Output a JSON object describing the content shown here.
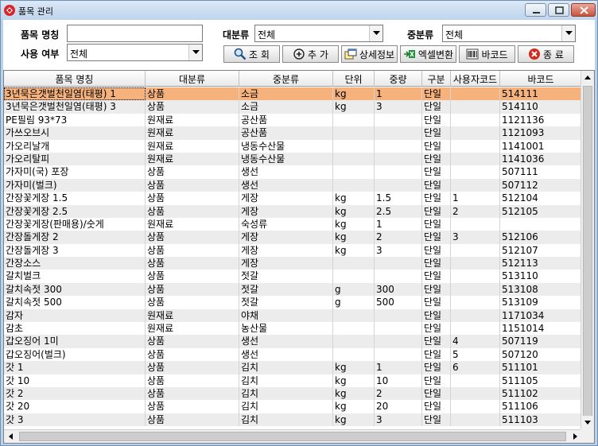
{
  "window": {
    "title": "품목 관리"
  },
  "filters": {
    "item_name_label": "품목 명칭",
    "item_name_value": "",
    "usage_label": "사용 여부",
    "usage_value": "전체",
    "major_label": "대분류",
    "major_value": "전체",
    "minor_label": "중분류",
    "minor_value": "전체"
  },
  "toolbar": {
    "search_label": "조 회",
    "add_label": "추 가",
    "detail_label": "상세정보",
    "excel_label": "엑셀변환",
    "barcode_label": "바코드",
    "close_label": "종 료"
  },
  "grid": {
    "columns": [
      "품목 명칭",
      "대분류",
      "중분류",
      "단위",
      "중량",
      "구분",
      "사용자코드",
      "바코드"
    ],
    "rows": [
      [
        "3년묵은갯벌천일염(태평) 1",
        "상품",
        "소금",
        "kg",
        "1",
        "단일",
        "",
        "514111"
      ],
      [
        "3년묵은갯벌천일염(태평) 3",
        "상품",
        "소금",
        "kg",
        "3",
        "단일",
        "",
        "514110"
      ],
      [
        "PE필림 93*73",
        "원재료",
        "공산품",
        "",
        "",
        "단일",
        "",
        "1121136"
      ],
      [
        "가쓰오브시",
        "원재료",
        "공산품",
        "",
        "",
        "단일",
        "",
        "1121093"
      ],
      [
        "가오리날개",
        "원재료",
        "냉동수산물",
        "",
        "",
        "단일",
        "",
        "1141001"
      ],
      [
        "가오리탈피",
        "원재료",
        "냉동수산물",
        "",
        "",
        "단일",
        "",
        "1141036"
      ],
      [
        "가자미(국) 포장",
        "상품",
        "생선",
        "",
        "",
        "단일",
        "",
        "507111"
      ],
      [
        "가자미(벌크)",
        "상품",
        "생선",
        "",
        "",
        "단일",
        "",
        "507112"
      ],
      [
        "간장꽃게장 1.5",
        "상품",
        "게장",
        "kg",
        "1.5",
        "단일",
        "1",
        "512104"
      ],
      [
        "간장꽃게장 2.5",
        "상품",
        "게장",
        "kg",
        "2.5",
        "단일",
        "2",
        "512105"
      ],
      [
        "간장꽃게장(판매용)/숫게",
        "원재료",
        "숙성류",
        "kg",
        "1",
        "단일",
        "",
        ""
      ],
      [
        "간장돌게장 2",
        "상품",
        "게장",
        "kg",
        "2",
        "단일",
        "3",
        "512106"
      ],
      [
        "간장돌게장 3",
        "상품",
        "게장",
        "kg",
        "3",
        "단일",
        "",
        "512107"
      ],
      [
        "간장소스",
        "상품",
        "게장",
        "",
        "",
        "단일",
        "",
        "512113"
      ],
      [
        "갈치벌크",
        "상품",
        "젓갈",
        "",
        "",
        "단일",
        "",
        "513110"
      ],
      [
        "갈치속젓 300",
        "상품",
        "젓갈",
        "g",
        "300",
        "단일",
        "",
        "513108"
      ],
      [
        "갈치속젓 500",
        "상품",
        "젓갈",
        "g",
        "500",
        "단일",
        "",
        "513109"
      ],
      [
        "감자",
        "원재료",
        "야채",
        "",
        "",
        "단일",
        "",
        "1171034"
      ],
      [
        "감초",
        "원재료",
        "농산물",
        "",
        "",
        "단일",
        "",
        "1151014"
      ],
      [
        "갑오징어 1미",
        "상품",
        "생선",
        "",
        "",
        "단일",
        "4",
        "507119"
      ],
      [
        "갑오징어(벌크)",
        "상품",
        "생선",
        "",
        "",
        "단일",
        "5",
        "507120"
      ],
      [
        "갓 1",
        "상품",
        "김치",
        "kg",
        "1",
        "단일",
        "6",
        "511101"
      ],
      [
        "갓 10",
        "상품",
        "김치",
        "kg",
        "10",
        "단일",
        "",
        "511105"
      ],
      [
        "갓 2",
        "상품",
        "김치",
        "kg",
        "2",
        "단일",
        "",
        "511102"
      ],
      [
        "갓 20",
        "상품",
        "김치",
        "kg",
        "20",
        "단일",
        "",
        "511106"
      ],
      [
        "갓 3",
        "상품",
        "김치",
        "kg",
        "3",
        "단일",
        "",
        "511103"
      ]
    ]
  },
  "icons": {
    "app": "app-logo-icon",
    "search": "magnifier-icon",
    "add": "plus-circle-icon",
    "detail": "detail-window-icon",
    "excel": "excel-icon",
    "barcode": "barcode-icon",
    "close": "close-circle-icon"
  },
  "colors": {
    "selected_row": "#f5b27c",
    "alt_row": "#ececec",
    "frame": "#b9d1ea"
  }
}
